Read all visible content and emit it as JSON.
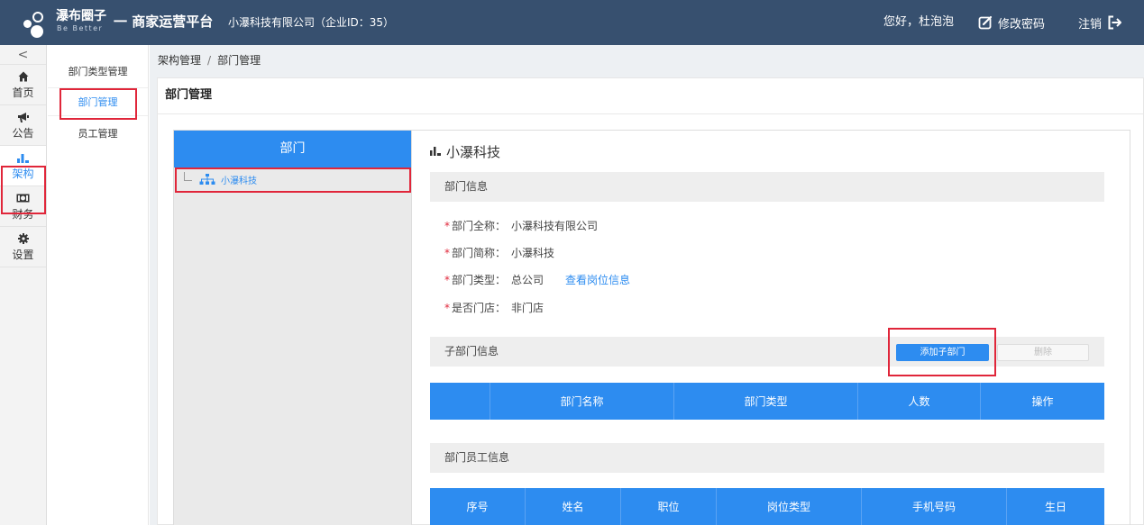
{
  "header": {
    "brand_cn": "瀑布圈子",
    "brand_en": "Be Better",
    "platform": "一 商家运营平台",
    "company": "小瀑科技有限公司（企业ID：35）",
    "greeting": "您好，杜泡泡",
    "change_password": "修改密码",
    "logout": "注销"
  },
  "nav": {
    "collapse": "<",
    "items": [
      {
        "label": "首页",
        "icon": "home-icon"
      },
      {
        "label": "公告",
        "icon": "megaphone-icon"
      },
      {
        "label": "架构",
        "icon": "bar-chart-icon"
      },
      {
        "label": "财务",
        "icon": "money-icon"
      },
      {
        "label": "设置",
        "icon": "gear-icon"
      }
    ],
    "active": "架构"
  },
  "submenu": {
    "items": [
      "部门类型管理",
      "部门管理",
      "员工管理"
    ],
    "active": "部门管理"
  },
  "breadcrumb": {
    "parent": "架构管理",
    "separator": "/",
    "current": "部门管理"
  },
  "panel": {
    "title": "部门管理"
  },
  "tree": {
    "header": "部门",
    "nodes": [
      {
        "label": "小瀑科技",
        "icon": "org-tree-icon",
        "selected": true
      }
    ]
  },
  "details": {
    "title": "小瀑科技",
    "info_section": "部门信息",
    "fields": {
      "full_name": {
        "label": "部门全称：",
        "value": "小瀑科技有限公司"
      },
      "short_name": {
        "label": "部门简称：",
        "value": "小瀑科技"
      },
      "type": {
        "label": "部门类型：",
        "value": "总公司",
        "link": "查看岗位信息"
      },
      "is_store": {
        "label": "是否门店：",
        "value": "非门店"
      }
    },
    "required_mark": "*",
    "sub_section": "子部门信息",
    "add_button": "添加子部门",
    "delete_button": "删除",
    "sub_columns": [
      "",
      "部门名称",
      "部门类型",
      "人数",
      "操作"
    ],
    "staff_section": "部门员工信息",
    "staff_columns": [
      "序号",
      "姓名",
      "职位",
      "岗位类型",
      "手机号码",
      "生日"
    ]
  },
  "colors": {
    "header_bg": "#37506f",
    "accent": "#2d8cf0",
    "highlight_box": "#e0263a"
  }
}
